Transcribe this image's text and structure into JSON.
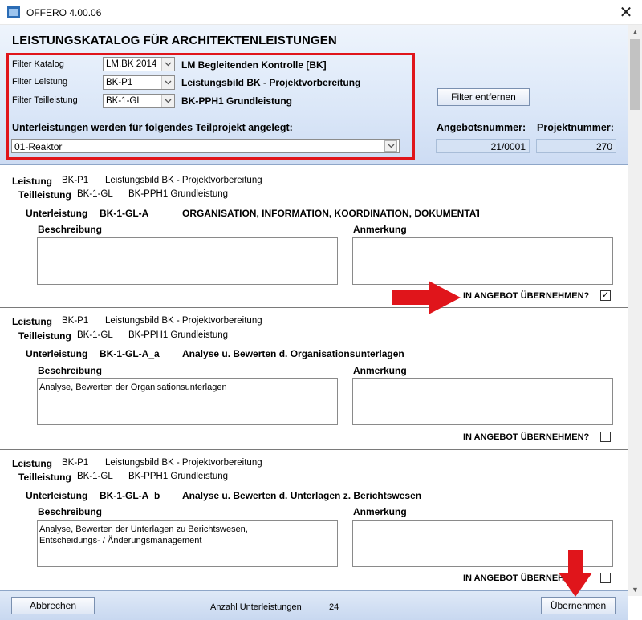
{
  "window": {
    "title": "OFFERO 4.00.06"
  },
  "header": {
    "title": "LEISTUNGSKATALOG FÜR ARCHITEKTENLEISTUNGEN",
    "filters": [
      {
        "label": "Filter Katalog",
        "value": "LM.BK 2014",
        "desc": "LM Begleitenden Kontrolle [BK]"
      },
      {
        "label": "Filter Leistung",
        "value": "BK-P1",
        "desc": "Leistungsbild BK - Projektvorbereitung"
      },
      {
        "label": "Filter Teilleistung",
        "value": "BK-1-GL",
        "desc": "BK-PPH1 Grundleistung"
      }
    ],
    "filter_remove_label": "Filter entfernen",
    "subproject_label": "Unterleistungen werden für folgendes Teilprojekt angelegt:",
    "subproject_value": "01-Reaktor",
    "offer_number_label": "Angebotsnummer:",
    "offer_number": "21/0001",
    "project_number_label": "Projektnummer:",
    "project_number": "270"
  },
  "labels": {
    "leistung": "Leistung",
    "teilleistung": "Teilleistung",
    "unterleistung": "Unterleistung",
    "beschreibung": "Beschreibung",
    "anmerkung": "Anmerkung",
    "uebernehmen_q": "IN ANGEBOT ÜBERNEHMEN?"
  },
  "items": [
    {
      "leistung_code": "BK-P1",
      "leistung_name": "Leistungsbild BK - Projektvorbereitung",
      "teil_code": "BK-1-GL",
      "teil_name": "BK-PPH1 Grundleistung",
      "unter_code": "BK-1-GL-A",
      "unter_name": "ORGANISATION, INFORMATION, KOORDINATION, DOKUMENTAT",
      "beschreibung": "",
      "anmerkung": "",
      "checked": "✓"
    },
    {
      "leistung_code": "BK-P1",
      "leistung_name": "Leistungsbild BK - Projektvorbereitung",
      "teil_code": "BK-1-GL",
      "teil_name": "BK-PPH1 Grundleistung",
      "unter_code": "BK-1-GL-A_a",
      "unter_name": "Analyse u. Bewerten d. Organisationsunterlagen",
      "beschreibung": "Analyse, Bewerten der Organisationsunterlagen",
      "anmerkung": "",
      "checked": ""
    },
    {
      "leistung_code": "BK-P1",
      "leistung_name": "Leistungsbild BK - Projektvorbereitung",
      "teil_code": "BK-1-GL",
      "teil_name": "BK-PPH1 Grundleistung",
      "unter_code": "BK-1-GL-A_b",
      "unter_name": "Analyse u. Bewerten d. Unterlagen z. Berichtswesen",
      "beschreibung": "Analyse, Bewerten der Unterlagen zu Berichtswesen,\nEntscheidungs- / Änderungsmanagement",
      "anmerkung": "",
      "checked": ""
    }
  ],
  "footer": {
    "cancel_label": "Abbrechen",
    "count_label": "Anzahl Unterleistungen",
    "count_value": "24",
    "apply_label": "Übernehmen"
  },
  "colors": {
    "highlight_red": "#e0151b",
    "header_blue": "#dbe7f8"
  }
}
